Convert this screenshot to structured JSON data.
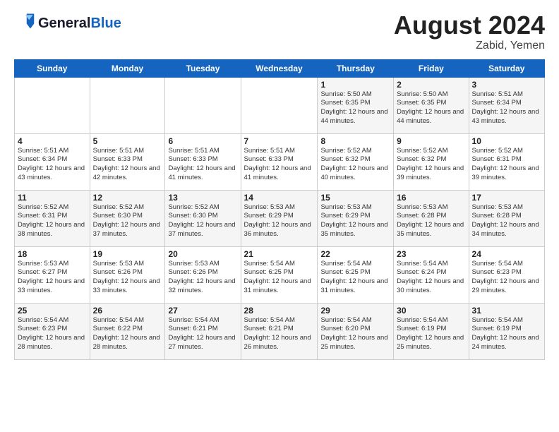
{
  "header": {
    "logo_line1": "General",
    "logo_line2": "Blue",
    "title": "August 2024",
    "subtitle": "Zabid, Yemen"
  },
  "weekdays": [
    "Sunday",
    "Monday",
    "Tuesday",
    "Wednesday",
    "Thursday",
    "Friday",
    "Saturday"
  ],
  "weeks": [
    [
      {
        "day": "",
        "info": ""
      },
      {
        "day": "",
        "info": ""
      },
      {
        "day": "",
        "info": ""
      },
      {
        "day": "",
        "info": ""
      },
      {
        "day": "1",
        "info": "Sunrise: 5:50 AM\nSunset: 6:35 PM\nDaylight: 12 hours\nand 44 minutes."
      },
      {
        "day": "2",
        "info": "Sunrise: 5:50 AM\nSunset: 6:35 PM\nDaylight: 12 hours\nand 44 minutes."
      },
      {
        "day": "3",
        "info": "Sunrise: 5:51 AM\nSunset: 6:34 PM\nDaylight: 12 hours\nand 43 minutes."
      }
    ],
    [
      {
        "day": "4",
        "info": "Sunrise: 5:51 AM\nSunset: 6:34 PM\nDaylight: 12 hours\nand 43 minutes."
      },
      {
        "day": "5",
        "info": "Sunrise: 5:51 AM\nSunset: 6:33 PM\nDaylight: 12 hours\nand 42 minutes."
      },
      {
        "day": "6",
        "info": "Sunrise: 5:51 AM\nSunset: 6:33 PM\nDaylight: 12 hours\nand 41 minutes."
      },
      {
        "day": "7",
        "info": "Sunrise: 5:51 AM\nSunset: 6:33 PM\nDaylight: 12 hours\nand 41 minutes."
      },
      {
        "day": "8",
        "info": "Sunrise: 5:52 AM\nSunset: 6:32 PM\nDaylight: 12 hours\nand 40 minutes."
      },
      {
        "day": "9",
        "info": "Sunrise: 5:52 AM\nSunset: 6:32 PM\nDaylight: 12 hours\nand 39 minutes."
      },
      {
        "day": "10",
        "info": "Sunrise: 5:52 AM\nSunset: 6:31 PM\nDaylight: 12 hours\nand 39 minutes."
      }
    ],
    [
      {
        "day": "11",
        "info": "Sunrise: 5:52 AM\nSunset: 6:31 PM\nDaylight: 12 hours\nand 38 minutes."
      },
      {
        "day": "12",
        "info": "Sunrise: 5:52 AM\nSunset: 6:30 PM\nDaylight: 12 hours\nand 37 minutes."
      },
      {
        "day": "13",
        "info": "Sunrise: 5:52 AM\nSunset: 6:30 PM\nDaylight: 12 hours\nand 37 minutes."
      },
      {
        "day": "14",
        "info": "Sunrise: 5:53 AM\nSunset: 6:29 PM\nDaylight: 12 hours\nand 36 minutes."
      },
      {
        "day": "15",
        "info": "Sunrise: 5:53 AM\nSunset: 6:29 PM\nDaylight: 12 hours\nand 35 minutes."
      },
      {
        "day": "16",
        "info": "Sunrise: 5:53 AM\nSunset: 6:28 PM\nDaylight: 12 hours\nand 35 minutes."
      },
      {
        "day": "17",
        "info": "Sunrise: 5:53 AM\nSunset: 6:28 PM\nDaylight: 12 hours\nand 34 minutes."
      }
    ],
    [
      {
        "day": "18",
        "info": "Sunrise: 5:53 AM\nSunset: 6:27 PM\nDaylight: 12 hours\nand 33 minutes."
      },
      {
        "day": "19",
        "info": "Sunrise: 5:53 AM\nSunset: 6:26 PM\nDaylight: 12 hours\nand 33 minutes."
      },
      {
        "day": "20",
        "info": "Sunrise: 5:53 AM\nSunset: 6:26 PM\nDaylight: 12 hours\nand 32 minutes."
      },
      {
        "day": "21",
        "info": "Sunrise: 5:54 AM\nSunset: 6:25 PM\nDaylight: 12 hours\nand 31 minutes."
      },
      {
        "day": "22",
        "info": "Sunrise: 5:54 AM\nSunset: 6:25 PM\nDaylight: 12 hours\nand 31 minutes."
      },
      {
        "day": "23",
        "info": "Sunrise: 5:54 AM\nSunset: 6:24 PM\nDaylight: 12 hours\nand 30 minutes."
      },
      {
        "day": "24",
        "info": "Sunrise: 5:54 AM\nSunset: 6:23 PM\nDaylight: 12 hours\nand 29 minutes."
      }
    ],
    [
      {
        "day": "25",
        "info": "Sunrise: 5:54 AM\nSunset: 6:23 PM\nDaylight: 12 hours\nand 28 minutes."
      },
      {
        "day": "26",
        "info": "Sunrise: 5:54 AM\nSunset: 6:22 PM\nDaylight: 12 hours\nand 28 minutes."
      },
      {
        "day": "27",
        "info": "Sunrise: 5:54 AM\nSunset: 6:21 PM\nDaylight: 12 hours\nand 27 minutes."
      },
      {
        "day": "28",
        "info": "Sunrise: 5:54 AM\nSunset: 6:21 PM\nDaylight: 12 hours\nand 26 minutes."
      },
      {
        "day": "29",
        "info": "Sunrise: 5:54 AM\nSunset: 6:20 PM\nDaylight: 12 hours\nand 25 minutes."
      },
      {
        "day": "30",
        "info": "Sunrise: 5:54 AM\nSunset: 6:19 PM\nDaylight: 12 hours\nand 25 minutes."
      },
      {
        "day": "31",
        "info": "Sunrise: 5:54 AM\nSunset: 6:19 PM\nDaylight: 12 hours\nand 24 minutes."
      }
    ]
  ]
}
